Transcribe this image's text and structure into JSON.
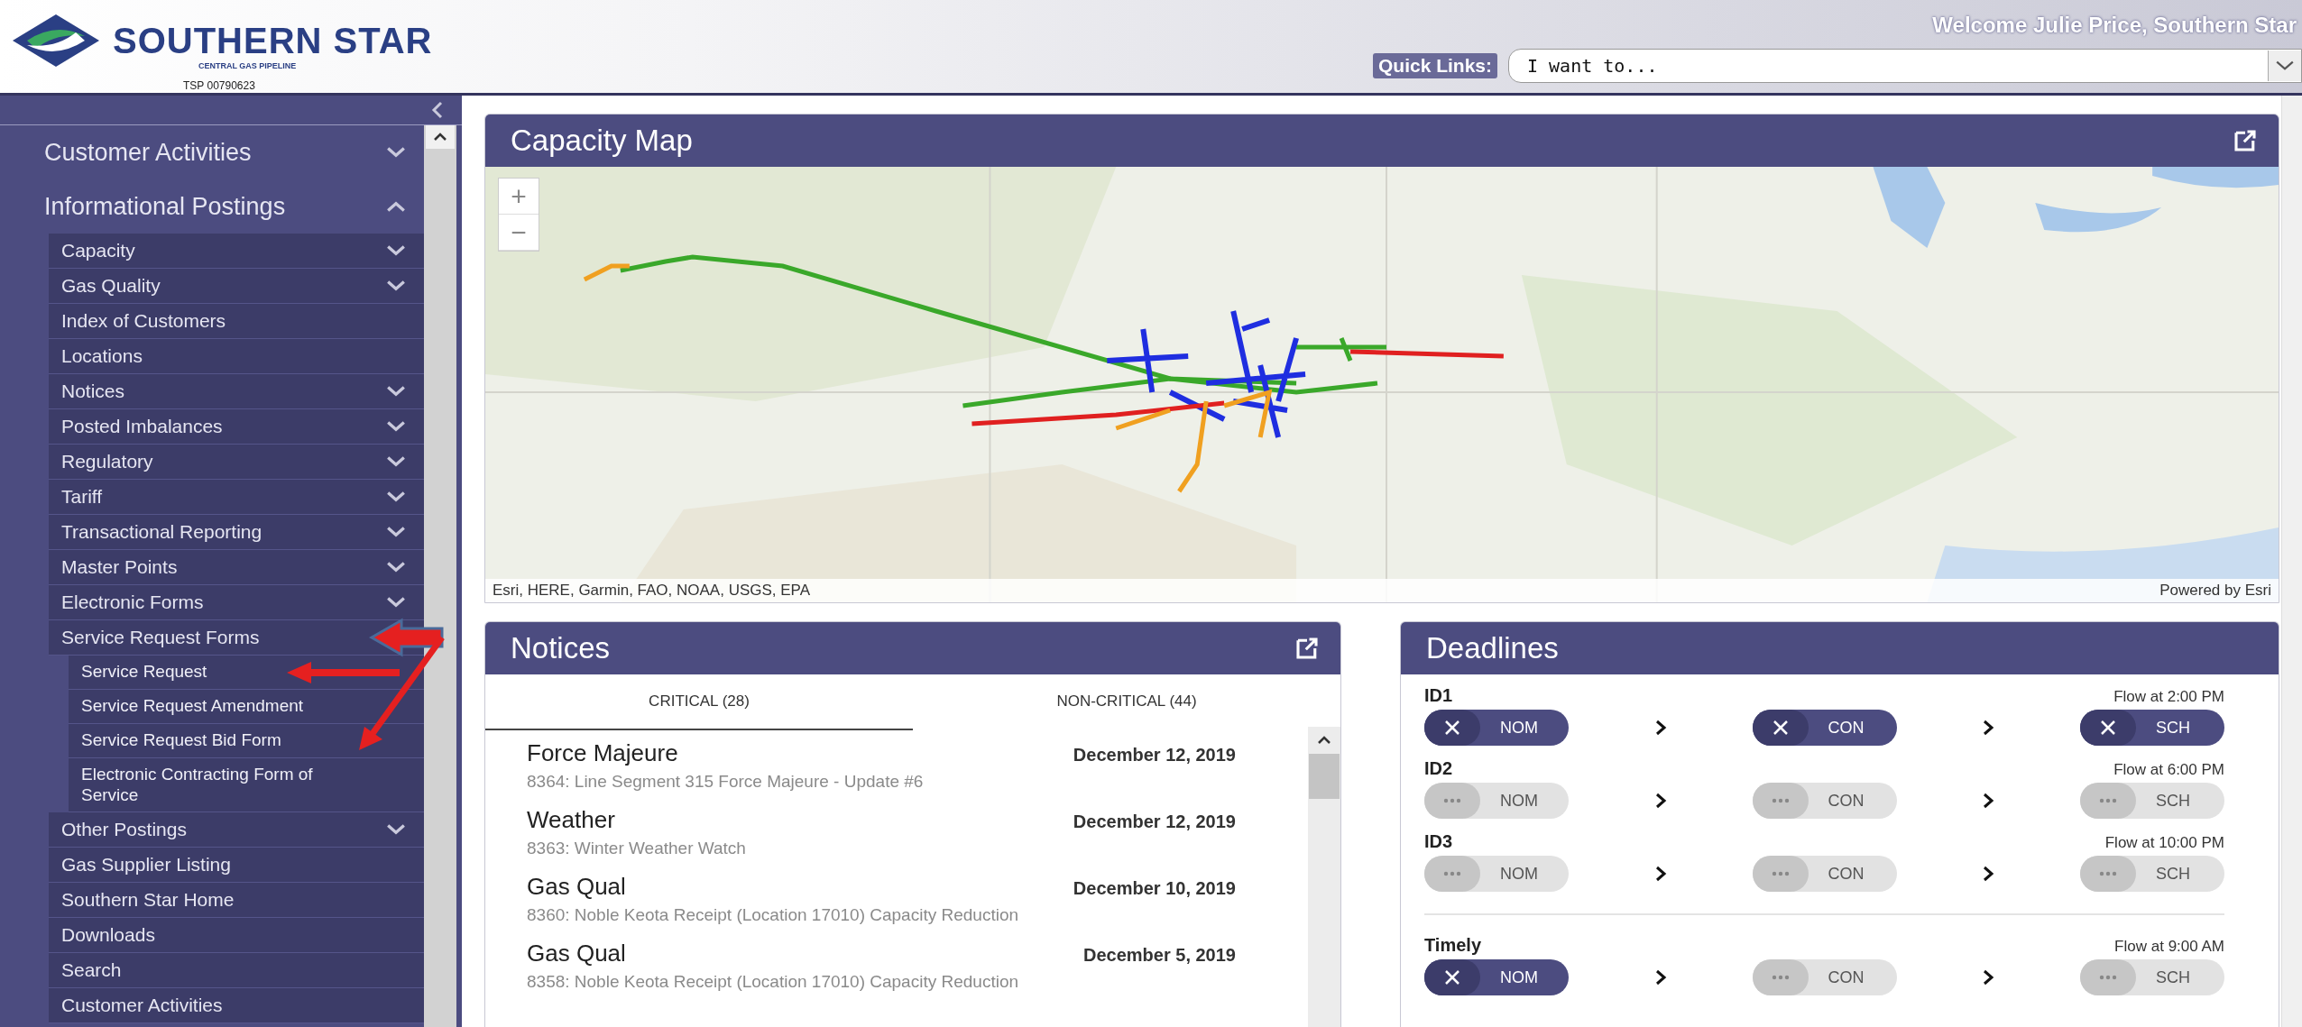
{
  "header": {
    "logo_name": "SOUTHERN STAR",
    "logo_tagline": "CENTRAL GAS PIPELINE",
    "tsp": "TSP 00790623",
    "welcome": "Welcome Julie Price, Southern Star",
    "quick_links_label": "Quick Links:",
    "quick_links_value": "I want to..."
  },
  "sidebar": {
    "items": [
      {
        "label": "Customer Activities",
        "kind": "group",
        "expanded": false
      },
      {
        "label": "Informational Postings",
        "kind": "group",
        "expanded": true,
        "children": [
          {
            "label": "Capacity",
            "kind": "group",
            "expanded": false
          },
          {
            "label": "Gas Quality",
            "kind": "group",
            "expanded": false
          },
          {
            "label": "Index of Customers",
            "kind": "link"
          },
          {
            "label": "Locations",
            "kind": "link"
          },
          {
            "label": "Notices",
            "kind": "group",
            "expanded": false
          },
          {
            "label": "Posted Imbalances",
            "kind": "group",
            "expanded": false
          },
          {
            "label": "Regulatory",
            "kind": "group",
            "expanded": false
          },
          {
            "label": "Tariff",
            "kind": "group",
            "expanded": false
          },
          {
            "label": "Transactional Reporting",
            "kind": "group",
            "expanded": false
          },
          {
            "label": "Master Points",
            "kind": "group",
            "expanded": false
          },
          {
            "label": "Electronic Forms",
            "kind": "group",
            "expanded": false
          },
          {
            "label": "Service Request Forms",
            "kind": "link",
            "children": [
              {
                "label": "Service Request",
                "kind": "link"
              },
              {
                "label": "Service Request Amendment",
                "kind": "link"
              },
              {
                "label": "Service Request Bid Form",
                "kind": "link"
              },
              {
                "label": "Electronic Contracting Form of Service",
                "kind": "link"
              }
            ]
          },
          {
            "label": "Other Postings",
            "kind": "group",
            "expanded": false
          },
          {
            "label": "Gas Supplier Listing",
            "kind": "link"
          },
          {
            "label": "Southern Star Home",
            "kind": "link"
          },
          {
            "label": "Downloads",
            "kind": "link"
          },
          {
            "label": "Search",
            "kind": "link"
          },
          {
            "label": "Customer Activities",
            "kind": "link"
          }
        ]
      }
    ]
  },
  "capacity_map": {
    "title": "Capacity Map",
    "attribution": "Esri, HERE, Garmin, FAO, NOAA, USGS, EPA",
    "powered_by": "Powered by Esri",
    "zoom_in": "+",
    "zoom_out": "−"
  },
  "notices": {
    "title": "Notices",
    "tabs": [
      {
        "label": "CRITICAL (28)",
        "selected": true
      },
      {
        "label": "NON-CRITICAL (44)",
        "selected": false
      }
    ],
    "items": [
      {
        "title": "Force Majeure",
        "date": "December 12, 2019",
        "description": "8364: Line Segment 315 Force Majeure - Update #6"
      },
      {
        "title": "Weather",
        "date": "December 12, 2019",
        "description": "8363: Winter Weather Watch"
      },
      {
        "title": "Gas Qual",
        "date": "December 10, 2019",
        "description": "8360: Noble Keota Receipt (Location 17010) Capacity Reduction"
      },
      {
        "title": "Gas Qual",
        "date": "December 5, 2019",
        "description": "8358: Noble Keota Receipt (Location 17010) Capacity Reduction"
      }
    ]
  },
  "deadlines": {
    "title": "Deadlines",
    "rows": [
      {
        "label": "ID1",
        "flow": "Flow at 2:00 PM",
        "steps": [
          {
            "label": "NOM",
            "done": true
          },
          {
            "label": "CON",
            "done": true
          },
          {
            "label": "SCH",
            "done": true
          }
        ]
      },
      {
        "label": "ID2",
        "flow": "Flow at 6:00 PM",
        "steps": [
          {
            "label": "NOM",
            "done": false
          },
          {
            "label": "CON",
            "done": false
          },
          {
            "label": "SCH",
            "done": false
          }
        ]
      },
      {
        "label": "ID3",
        "flow": "Flow at 10:00 PM",
        "steps": [
          {
            "label": "NOM",
            "done": false
          },
          {
            "label": "CON",
            "done": false
          },
          {
            "label": "SCH",
            "done": false
          }
        ]
      },
      {
        "label": "Timely",
        "flow": "Flow at 9:00 AM",
        "separated": true,
        "steps": [
          {
            "label": "NOM",
            "done": true
          },
          {
            "label": "CON",
            "done": false
          },
          {
            "label": "SCH",
            "done": false
          }
        ]
      }
    ]
  }
}
